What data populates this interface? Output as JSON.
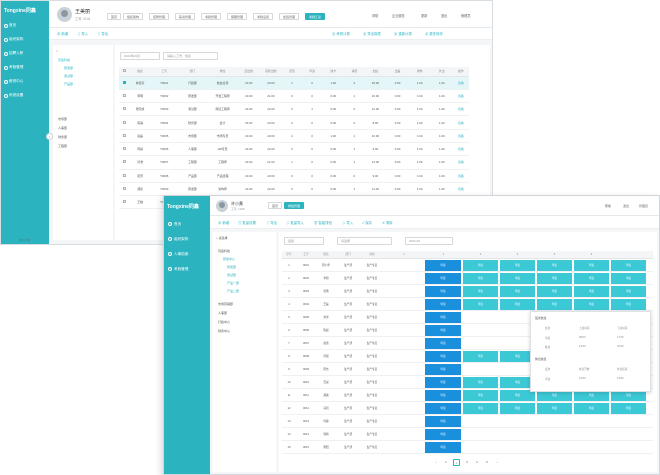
{
  "brand": "Tongxine同鑫",
  "colors": {
    "accent": "#2bb3c0",
    "blue": "#1a8fdc",
    "teal": "#3cc9d6"
  },
  "w1": {
    "nav": [
      "首页",
      "组织架构",
      "招聘入职",
      "考勤管理",
      "薪资中心",
      "系统设置"
    ],
    "user": {
      "name": "王美丽",
      "sub": "工号: 0104"
    },
    "tabs": [
      "首页",
      "组织架构",
      "招聘管理",
      "薪资管理",
      "考勤管理",
      "假期管理",
      "考勤设置",
      "加班管理",
      "考勤汇总"
    ],
    "top_right": [
      "帮助",
      "企业服务",
      "更新",
      "退出",
      "管理员"
    ],
    "toolbar_left": [
      "新增",
      "导入",
      "导出"
    ],
    "toolbar_right": [
      "考勤计算",
      "导出报表",
      "重新计算",
      "更多操作"
    ],
    "tree": [
      "同鑫科技",
      "研发部",
      "测试部",
      "产品部",
      "市场部",
      "人事部",
      "财务部",
      "工程部"
    ],
    "filters": [
      "2022年09月",
      "请输入工号、姓名"
    ],
    "headers": [
      "",
      "姓名",
      "工号",
      "部门",
      "岗位",
      "应出勤",
      "实际出勤",
      "迟到",
      "早退",
      "缺卡",
      "请假",
      "加班",
      "出差",
      "调休",
      "外出",
      "操作"
    ],
    "rows": [
      [
        "",
        "林佳莹",
        "T0001",
        "行政部",
        "前台接待",
        "23.00",
        "20.00",
        "1",
        "0",
        "1.00",
        "2",
        "18.00",
        "0.00",
        "1.00",
        "1.00",
        "查看"
      ],
      [
        "",
        "李明",
        "T0002",
        "研发部",
        "开发工程师",
        "23.00",
        "21.00",
        "0",
        "0",
        "0.00",
        "1",
        "16.00",
        "0.00",
        "1.00",
        "1.00",
        "查看"
      ],
      [
        "",
        "张晓峰",
        "T0003",
        "测试部",
        "测试工程师",
        "23.00",
        "22.00",
        "0",
        "1",
        "0.00",
        "0",
        "12.00",
        "0.00",
        "1.00",
        "1.00",
        "查看"
      ],
      [
        "",
        "陈静",
        "T0004",
        "财务部",
        "会计",
        "23.00",
        "23.00",
        "0",
        "0",
        "0.00",
        "0",
        "8.00",
        "0.00",
        "1.00",
        "1.00",
        "查看"
      ],
      [
        "",
        "赵磊",
        "T0005",
        "市场部",
        "市场专员",
        "23.00",
        "20.00",
        "2",
        "0",
        "1.00",
        "1",
        "10.00",
        "0.00",
        "1.00",
        "1.00",
        "查看"
      ],
      [
        "",
        "周婷",
        "T0006",
        "人事部",
        "HR专员",
        "23.00",
        "22.00",
        "0",
        "0",
        "0.00",
        "1",
        "6.00",
        "0.00",
        "1.00",
        "1.00",
        "查看"
      ],
      [
        "",
        "孙浩",
        "T0007",
        "工程部",
        "工程师",
        "23.00",
        "21.00",
        "1",
        "0",
        "0.00",
        "1",
        "14.00",
        "0.00",
        "1.00",
        "1.00",
        "查看"
      ],
      [
        "",
        "吴芳",
        "T0008",
        "产品部",
        "产品经理",
        "23.00",
        "23.00",
        "0",
        "0",
        "0.00",
        "0",
        "9.00",
        "0.00",
        "1.00",
        "1.00",
        "查看"
      ],
      [
        "",
        "郑凯",
        "T0009",
        "研发部",
        "架构师",
        "23.00",
        "22.00",
        "0",
        "0",
        "0.00",
        "1",
        "11.00",
        "0.00",
        "1.00",
        "1.00",
        "查看"
      ],
      [
        "",
        "王敏",
        "T0010",
        "行政部",
        "行政专员",
        "23.00",
        "20.00",
        "1",
        "1",
        "1.00",
        "1",
        "5.00",
        "0.00",
        "1.00",
        "1.00",
        "查看"
      ]
    ],
    "pager": "共 10 条"
  },
  "w2": {
    "nav": [
      "首页",
      "组织架构",
      "人事档案",
      "考勤管理"
    ],
    "user": {
      "name": "许小黄",
      "sub": "工号: 1208"
    },
    "tabs": [
      "首页",
      "排班管理"
    ],
    "top_right": [
      "帮助",
      "退出",
      "管理员"
    ],
    "toolbar": [
      "新增",
      "批量设置",
      "导出",
      "批量导入",
      "智能排班",
      "导入",
      "保存",
      "清除"
    ],
    "tree": [
      "同鑫科技",
      "研发中心",
      "研发部",
      "测试部",
      "产品一部",
      "产品二部",
      "市场营销部",
      "人事部",
      "行政中心",
      "财务中心"
    ],
    "filters": [
      "班组",
      "请选择",
      "2022-09"
    ],
    "headers": [
      "序号",
      "工号",
      "姓名",
      "部门",
      "岗位",
      "1",
      "2",
      "3",
      "4",
      "5",
      "6"
    ],
    "rows": [
      [
        "1",
        "0001",
        "周小华",
        "生产部",
        "生产专员"
      ],
      [
        "2",
        "0002",
        "李想",
        "生产部",
        "生产专员"
      ],
      [
        "3",
        "0003",
        "张扬",
        "生产部",
        "生产专员"
      ],
      [
        "4",
        "0004",
        "王磊",
        "生产部",
        "生产专员"
      ],
      [
        "5",
        "0005",
        "刘洋",
        "生产部",
        "生产专员"
      ],
      [
        "6",
        "0006",
        "陈晨",
        "生产部",
        "生产专员"
      ],
      [
        "7",
        "0007",
        "赵雷",
        "生产部",
        "生产专员"
      ],
      [
        "8",
        "0008",
        "孙丽",
        "生产部",
        "生产专员"
      ],
      [
        "9",
        "0009",
        "周杰",
        "生产部",
        "生产专员"
      ],
      [
        "10",
        "0010",
        "吴昊",
        "生产部",
        "生产专员"
      ],
      [
        "11",
        "0011",
        "郑爽",
        "生产部",
        "生产专员"
      ],
      [
        "12",
        "0012",
        "冯凯",
        "生产部",
        "生产专员"
      ],
      [
        "13",
        "0013",
        "何静",
        "生产部",
        "生产专员"
      ],
      [
        "14",
        "0014",
        "韩梅",
        "生产部",
        "生产专员"
      ],
      [
        "15",
        "0015",
        "曹阳",
        "生产部",
        "生产专员"
      ]
    ],
    "shift_blue": "早班",
    "shift_teal": "早班",
    "popup": {
      "title1": "班次信息",
      "cols": [
        "班次",
        "上班时间",
        "下班时间"
      ],
      "rows": [
        [
          "早班",
          "08:00",
          "17:00"
        ],
        [
          "晚班",
          "13:00",
          "22:00"
        ]
      ],
      "title2": "休息信息",
      "cols2": [
        "班次",
        "休息开始",
        "休息结束"
      ],
      "rows2": [
        [
          "早班",
          "12:00",
          "13:00"
        ]
      ]
    },
    "pagination": [
      "‹",
      "1",
      "2",
      "3",
      "4",
      "5",
      "›"
    ]
  }
}
